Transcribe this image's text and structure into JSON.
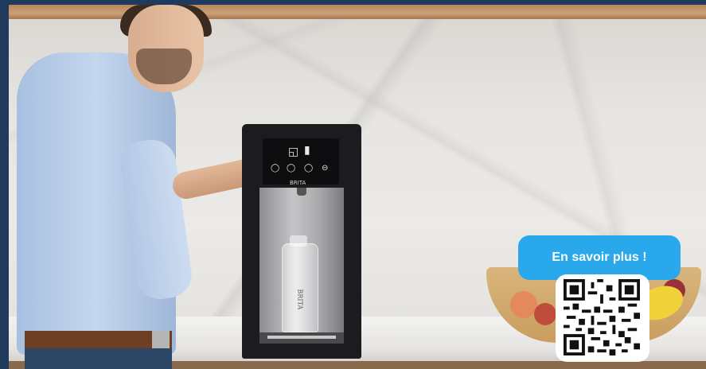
{
  "image": {
    "description_free": true,
    "cta": {
      "label": "En savoir plus !"
    },
    "dispenser": {
      "brand_label": "BRITA",
      "bottle_label": "BRITA"
    },
    "colors": {
      "cta_bg": "#29a9ec",
      "frame": "#1f3a5c"
    },
    "icons": [
      "glass-icon",
      "bottle-icon",
      "still-water-icon",
      "sparkling-water-icon",
      "menu-icon",
      "qr-code"
    ]
  }
}
